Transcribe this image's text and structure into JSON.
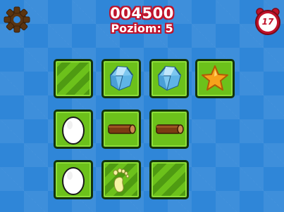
{
  "hud": {
    "score": "004500",
    "level": "Poziom: 5",
    "timer": "17",
    "settings_icon": "gear-icon",
    "timer_icon": "alarm-clock-icon"
  },
  "colors": {
    "background": "#2f86d8",
    "tile_green": "#6cc11b",
    "tile_border": "#13330c",
    "score_outline": "#c0122a",
    "gear": "#5a3410"
  },
  "board": {
    "rows": [
      [
        "hidden",
        "crystal",
        "crystal",
        "star"
      ],
      [
        "egg",
        "log",
        "log",
        null
      ],
      [
        "egg",
        "footprint",
        "hidden",
        null
      ]
    ]
  }
}
